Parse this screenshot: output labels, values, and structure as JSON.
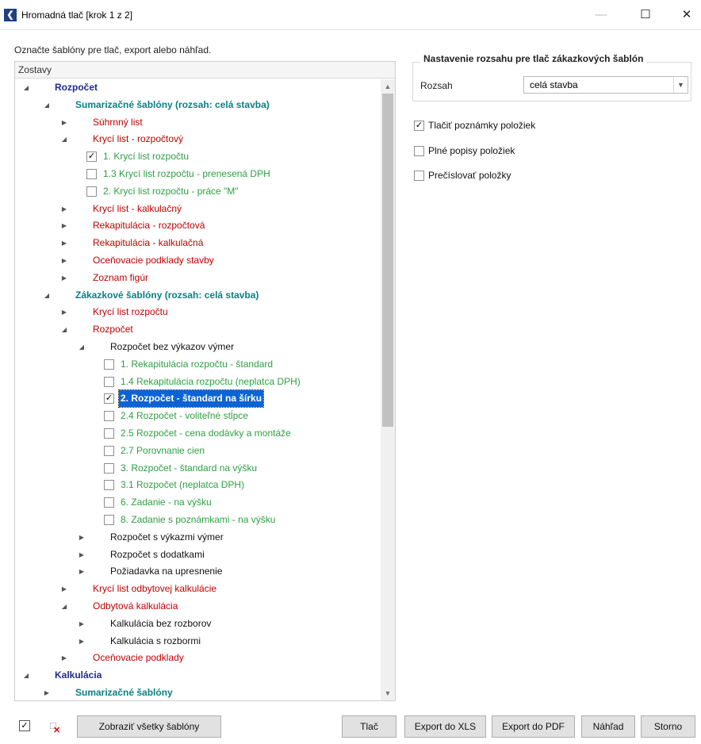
{
  "window": {
    "title": "Hromadná tlač [krok 1 z 2]",
    "back_icon": "arrow-left-icon",
    "minimize": "—",
    "maximize": "☐",
    "close": "✕"
  },
  "instruction": "Označte šablóny pre tlač, export alebo náhľad.",
  "tree": {
    "header": "Zostavy",
    "rows": [
      {
        "label": "Rozpočet",
        "indent": 0,
        "expander": "expanded",
        "style": "navy"
      },
      {
        "label": "Sumarizačné šablóny (rozsah: celá stavba)",
        "indent": 1,
        "expander": "expanded",
        "style": "teal"
      },
      {
        "label": "Súhrnný list",
        "indent": 2,
        "expander": "collapsed",
        "style": "red"
      },
      {
        "label": "Krycí list - rozpočtový",
        "indent": 2,
        "expander": "expanded",
        "style": "red"
      },
      {
        "label": "1. Krycí list rozpočtu",
        "indent": 3,
        "checkbox": true,
        "checked": true,
        "style": "green"
      },
      {
        "label": "1.3 Krycí list rozpočtu - prenesená DPH",
        "indent": 3,
        "checkbox": true,
        "checked": false,
        "style": "green"
      },
      {
        "label": "2. Krycí list rozpočtu - práce \"M\"",
        "indent": 3,
        "checkbox": true,
        "checked": false,
        "style": "green"
      },
      {
        "label": "Krycí list - kalkulačný",
        "indent": 2,
        "expander": "collapsed",
        "style": "red"
      },
      {
        "label": "Rekapitulácia - rozpočtová",
        "indent": 2,
        "expander": "collapsed",
        "style": "red"
      },
      {
        "label": "Rekapitulácia - kalkulačná",
        "indent": 2,
        "expander": "collapsed",
        "style": "red"
      },
      {
        "label": "Oceňovacie podklady stavby",
        "indent": 2,
        "expander": "collapsed",
        "style": "red"
      },
      {
        "label": "Zoznam figúr",
        "indent": 2,
        "expander": "collapsed",
        "style": "red"
      },
      {
        "label": "Zákazkové šablóny (rozsah: celá stavba)",
        "indent": 1,
        "expander": "expanded",
        "style": "teal"
      },
      {
        "label": "Krycí list rozpočtu",
        "indent": 2,
        "expander": "collapsed",
        "style": "red"
      },
      {
        "label": "Rozpočet",
        "indent": 2,
        "expander": "expanded",
        "style": "red"
      },
      {
        "label": "Rozpočet bez výkazov výmer",
        "indent": 3,
        "expander": "expanded",
        "style": "black"
      },
      {
        "label": "1. Rekapitulácia rozpočtu - štandard",
        "indent": 4,
        "checkbox": true,
        "checked": false,
        "style": "green"
      },
      {
        "label": "1.4 Rekapitulácia rozpočtu (neplatca DPH)",
        "indent": 4,
        "checkbox": true,
        "checked": false,
        "style": "green"
      },
      {
        "label": "2. Rozpočet - štandard na šírku",
        "indent": 4,
        "checkbox": true,
        "checked": true,
        "style": "green",
        "selected": true
      },
      {
        "label": "2.4 Rozpočet - voliteľné stĺpce",
        "indent": 4,
        "checkbox": true,
        "checked": false,
        "style": "green"
      },
      {
        "label": "2.5 Rozpočet - cena dodávky a montáže",
        "indent": 4,
        "checkbox": true,
        "checked": false,
        "style": "green"
      },
      {
        "label": "2.7 Porovnanie cien",
        "indent": 4,
        "checkbox": true,
        "checked": false,
        "style": "green"
      },
      {
        "label": "3. Rozpočet - štandard na výšku",
        "indent": 4,
        "checkbox": true,
        "checked": false,
        "style": "green"
      },
      {
        "label": "3.1 Rozpočet (neplatca DPH)",
        "indent": 4,
        "checkbox": true,
        "checked": false,
        "style": "green"
      },
      {
        "label": "6. Zadanie - na výšku",
        "indent": 4,
        "checkbox": true,
        "checked": false,
        "style": "green"
      },
      {
        "label": "8. Zadanie s poznámkami - na výšku",
        "indent": 4,
        "checkbox": true,
        "checked": false,
        "style": "green"
      },
      {
        "label": "Rozpočet s výkazmi výmer",
        "indent": 3,
        "expander": "collapsed",
        "style": "black"
      },
      {
        "label": "Rozpočet s dodatkami",
        "indent": 3,
        "expander": "collapsed",
        "style": "black"
      },
      {
        "label": "Požiadavka na upresnenie",
        "indent": 3,
        "expander": "collapsed",
        "style": "black"
      },
      {
        "label": "Krycí list odbytovej kalkulácie",
        "indent": 2,
        "expander": "collapsed",
        "style": "red"
      },
      {
        "label": "Odbytová kalkulácia",
        "indent": 2,
        "expander": "expanded",
        "style": "red"
      },
      {
        "label": "Kalkulácia bez rozborov",
        "indent": 3,
        "expander": "collapsed",
        "style": "black"
      },
      {
        "label": "Kalkulácia s rozbormi",
        "indent": 3,
        "expander": "collapsed",
        "style": "black"
      },
      {
        "label": "Oceňovacie podklady",
        "indent": 2,
        "expander": "collapsed",
        "style": "red"
      },
      {
        "label": "Kalkulácia",
        "indent": 0,
        "expander": "expanded",
        "style": "navy"
      },
      {
        "label": "Sumarizačné šablóny",
        "indent": 1,
        "expander": "collapsed",
        "style": "teal"
      }
    ]
  },
  "range_group": {
    "title": "Nastavenie rozsahu pre tlač zákazkových šablón",
    "label": "Rozsah",
    "value": "celá stavba"
  },
  "options": [
    {
      "label": "Tlačiť poznámky položiek",
      "checked": true
    },
    {
      "label": "Plné popisy položiek",
      "checked": false
    },
    {
      "label": "Prečíslovať položky",
      "checked": false
    }
  ],
  "buttons": {
    "show_all": "Zobraziť všetky šablóny",
    "print": "Tlač",
    "export_xls": "Export do XLS",
    "export_pdf": "Export do PDF",
    "preview": "Náhľad",
    "cancel": "Storno"
  },
  "colors": {
    "navy": "#1d2a8f",
    "teal": "#0b7f86",
    "red": "#c00000",
    "green": "#2ea043",
    "selection": "#0a64d8"
  }
}
